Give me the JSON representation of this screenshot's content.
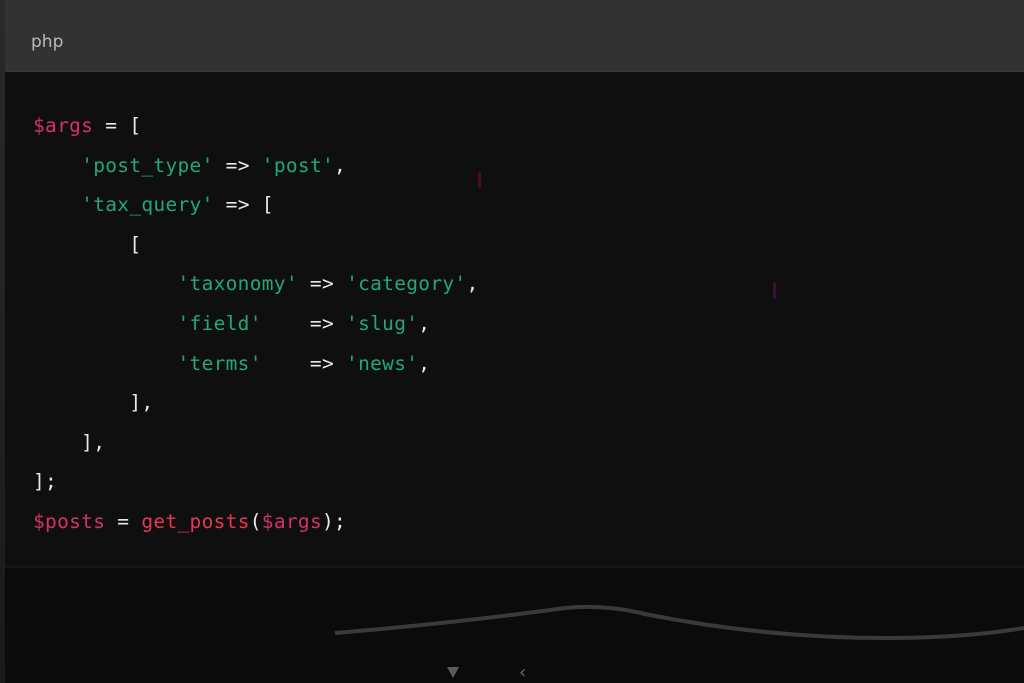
{
  "code_block": {
    "language": "php",
    "lines": [
      [
        {
          "t": "$args",
          "c": "var"
        },
        {
          "t": " = [",
          "c": "op"
        }
      ],
      [
        {
          "t": "    ",
          "c": "op"
        },
        {
          "t": "'post_type'",
          "c": "str"
        },
        {
          "t": " => ",
          "c": "op"
        },
        {
          "t": "'post'",
          "c": "str"
        },
        {
          "t": ",",
          "c": "op"
        }
      ],
      [
        {
          "t": "    ",
          "c": "op"
        },
        {
          "t": "'tax_query'",
          "c": "str"
        },
        {
          "t": " => [",
          "c": "op"
        }
      ],
      [
        {
          "t": "        [",
          "c": "op"
        }
      ],
      [
        {
          "t": "            ",
          "c": "op"
        },
        {
          "t": "'taxonomy'",
          "c": "str"
        },
        {
          "t": " => ",
          "c": "op"
        },
        {
          "t": "'category'",
          "c": "str"
        },
        {
          "t": ",",
          "c": "op"
        }
      ],
      [
        {
          "t": "            ",
          "c": "op"
        },
        {
          "t": "'field'",
          "c": "str"
        },
        {
          "t": "    => ",
          "c": "op"
        },
        {
          "t": "'slug'",
          "c": "str"
        },
        {
          "t": ",",
          "c": "op"
        }
      ],
      [
        {
          "t": "            ",
          "c": "op"
        },
        {
          "t": "'terms'",
          "c": "str"
        },
        {
          "t": "    => ",
          "c": "op"
        },
        {
          "t": "'news'",
          "c": "str"
        },
        {
          "t": ",",
          "c": "op"
        }
      ],
      [
        {
          "t": "        ],",
          "c": "op"
        }
      ],
      [
        {
          "t": "    ],",
          "c": "op"
        }
      ],
      [
        {
          "t": "];",
          "c": "op"
        }
      ],
      [
        {
          "t": "$posts",
          "c": "var"
        },
        {
          "t": " = ",
          "c": "op"
        },
        {
          "t": "get_posts",
          "c": "fn"
        },
        {
          "t": "(",
          "c": "op"
        },
        {
          "t": "$args",
          "c": "var"
        },
        {
          "t": ");",
          "c": "op"
        }
      ]
    ]
  },
  "colors": {
    "variable": "#d6306a",
    "function": "#e8374f",
    "string": "#21a875",
    "punctuation": "#e8e8e8",
    "header_bg": "#323232",
    "code_bg": "#0f0f10"
  },
  "footer": {
    "icons": [
      "triangle-down-icon",
      "chevron-left-icon"
    ],
    "chevron_glyph": "‹"
  }
}
